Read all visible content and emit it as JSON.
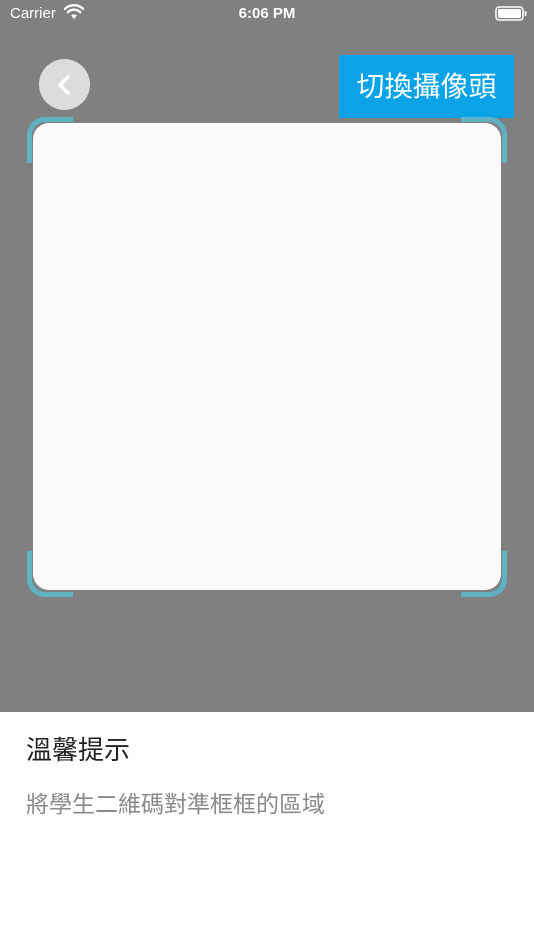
{
  "status_bar": {
    "carrier": "Carrier",
    "time": "6:06 PM",
    "wifi_icon": "wifi-icon",
    "battery_icon": "battery-icon"
  },
  "toolbar": {
    "back_icon": "chevron-left-icon",
    "switch_camera_label": "切換攝像頭"
  },
  "scanner": {
    "frame_color": "#5fb2c3"
  },
  "tips": {
    "title": "溫馨提示",
    "message": "將學生二維碼對準框框的區域"
  },
  "colors": {
    "accent": "#0aa3e8",
    "camera_background": "#808080"
  }
}
